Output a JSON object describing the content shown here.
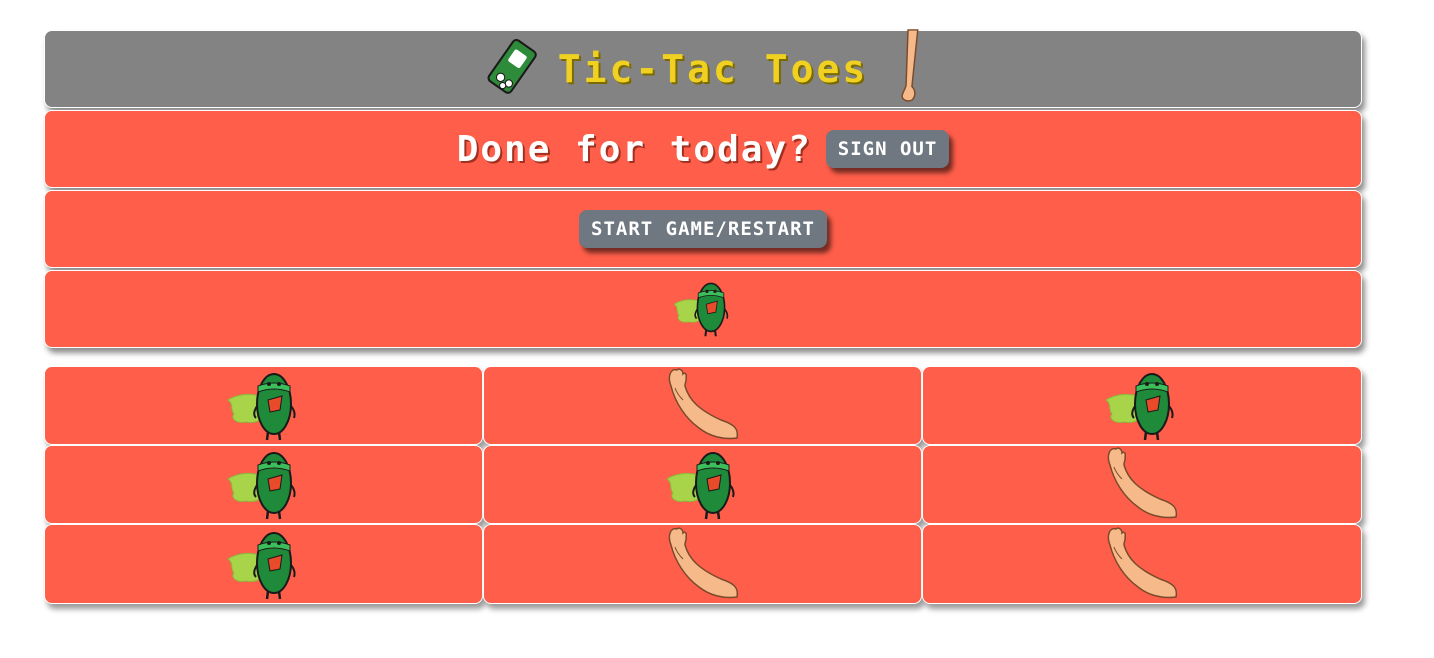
{
  "header": {
    "title": "Tic-Tac Toes",
    "left_icon": "tictac-box-icon",
    "right_icon": "foot-icon"
  },
  "account": {
    "prompt": "Done for today?",
    "sign_out_label": "SIGN OUT"
  },
  "controls": {
    "start_label": "START GAME/RESTART"
  },
  "turn": {
    "current_player": "tictac"
  },
  "colors": {
    "header_bg": "#838383",
    "panel_bg": "#ff5e4a",
    "title": "#f0d020",
    "button_bg": "#6f7780"
  },
  "board": [
    [
      "tictac",
      "foot",
      "tictac"
    ],
    [
      "tictac",
      "tictac",
      "foot"
    ],
    [
      "tictac",
      "foot",
      "foot"
    ]
  ]
}
